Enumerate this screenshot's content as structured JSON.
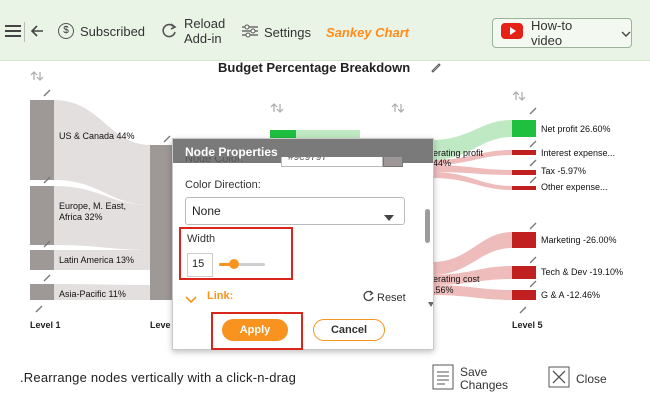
{
  "toolbar": {
    "subscribed_label": "Subscribed",
    "reload_label_line1": "Reload",
    "reload_label_line2": "Add-in",
    "settings_label": "Settings",
    "app_name": "Sankey Chart",
    "howto_label": "How-to video"
  },
  "chart": {
    "title": "Budget Percentage Breakdown",
    "levels": [
      "Level 1",
      "Level 5"
    ],
    "level_partial": "Leve",
    "left_nodes": [
      "US & Canada 44%",
      "Europe, M. East, Africa 32%",
      "Latin America 13%",
      "Asia-Pacific 11%"
    ],
    "mid_labels": [
      "erating profit",
      "44%",
      "erating cost",
      ".56%"
    ],
    "right_nodes": [
      "Net profit 26.60%",
      "Interest expense...",
      "Tax -5.97%",
      "Other expense...",
      "Marketing -26.00%",
      "Tech & Dev -19.10%",
      "G & A -12.46%"
    ],
    "colors": {
      "node_gray": "#9e9896",
      "flow_gray": "#e2dfde",
      "green": "#1fbf3f",
      "flow_green": "#bfe9c3",
      "red": "#c0201f",
      "flow_red": "#efbcbc"
    }
  },
  "dialog": {
    "title": "Node Properties",
    "node_color_label": "Node Color:",
    "node_color_value": "#9e9797",
    "color_direction_label": "Color Direction:",
    "color_direction_value": "None",
    "width_label": "Width",
    "width_value": "15",
    "width_fraction": 0.33,
    "link_label": "Link:",
    "reset_label": "Reset",
    "apply_label": "Apply",
    "cancel_label": "Cancel"
  },
  "footer": {
    "hint": ".Rearrange nodes vertically with a click-n-drag",
    "save_line1": "Save",
    "save_line2": "Changes",
    "close_label": "Close"
  }
}
